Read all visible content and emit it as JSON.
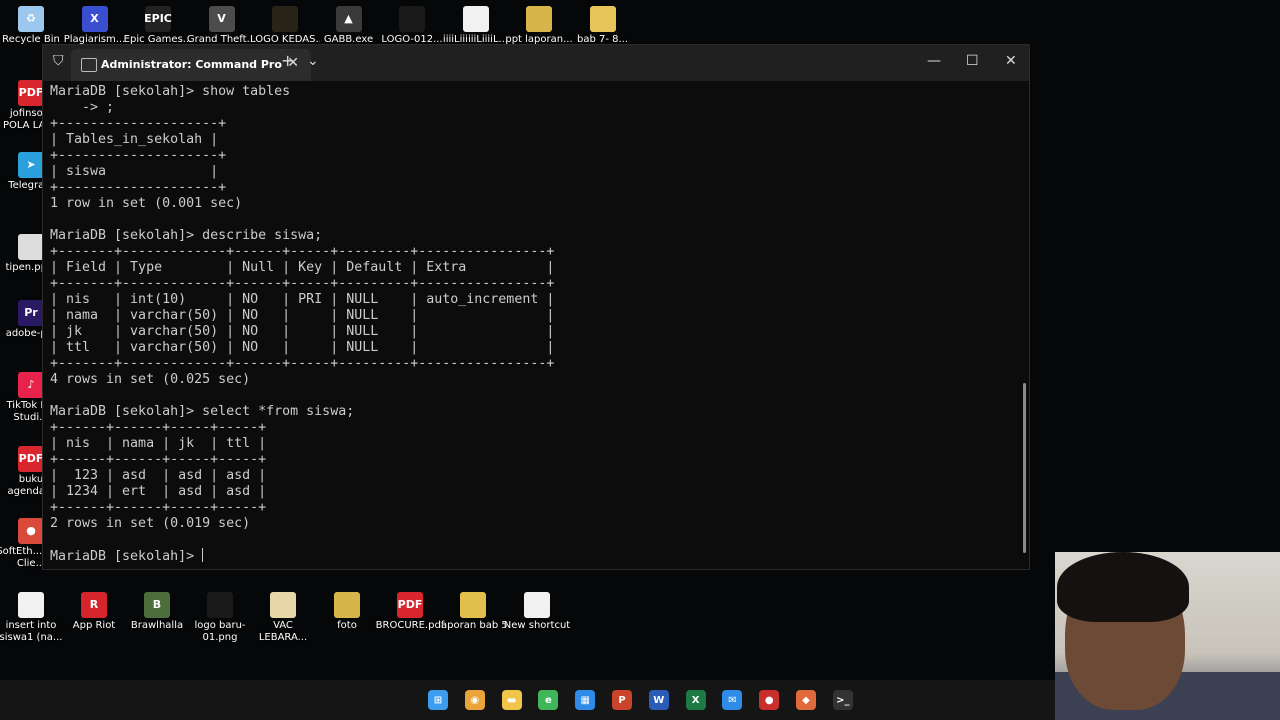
{
  "desktop": {
    "top_icons": [
      {
        "label": "Recycle Bin",
        "icon": "recycle-bin-icon",
        "color": "#9cc7ee",
        "glyph": "♻"
      },
      {
        "label": "Plagiarism...",
        "icon": "app-icon",
        "color": "#3a4fd0",
        "glyph": "X"
      },
      {
        "label": "Epic Games...",
        "icon": "epic-games-icon",
        "color": "#222222",
        "glyph": "EPIC"
      },
      {
        "label": "Grand Theft...",
        "icon": "gta-icon",
        "color": "#4c4c4c",
        "glyph": "V"
      },
      {
        "label": "LOGO KEDAS...",
        "icon": "image-icon",
        "color": "#2a2418",
        "glyph": ""
      },
      {
        "label": "GABB.exe",
        "icon": "exe-icon",
        "color": "#3a3a3a",
        "glyph": "▲"
      },
      {
        "label": "LOGO-012...",
        "icon": "image-icon",
        "color": "#1a1a1a",
        "glyph": ""
      },
      {
        "label": "iiiiLiiiiiiLiiiiL...",
        "icon": "document-icon",
        "color": "#f1f1f1",
        "glyph": ""
      },
      {
        "label": "ppt laporan...",
        "icon": "folder-icon",
        "color": "#d9b44a",
        "glyph": ""
      },
      {
        "label": "bab 7- 8...",
        "icon": "folder-icon",
        "color": "#e8c45a",
        "glyph": ""
      }
    ],
    "left_icons": [
      {
        "label": "jofinso... POLA LAT...",
        "icon": "pdf-icon",
        "color": "#d9262e",
        "glyph": "PDF"
      },
      {
        "label": "Telegra...",
        "icon": "telegram-icon",
        "color": "#2aa1da",
        "glyph": "➤"
      },
      {
        "label": "tipen.pp...",
        "icon": "image-icon",
        "color": "#dddddd",
        "glyph": ""
      },
      {
        "label": "adobe-p...",
        "icon": "premiere-icon",
        "color": "#2a1a66",
        "glyph": "Pr"
      },
      {
        "label": "TikTok L... Studi...",
        "icon": "tiktok-icon",
        "color": "#e8224a",
        "glyph": "♪"
      },
      {
        "label": "buku agenda...",
        "icon": "pdf-icon",
        "color": "#d9262e",
        "glyph": "PDF"
      },
      {
        "label": "SoftEth... VPN Clie...",
        "icon": "vpn-icon",
        "color": "#d94a3a",
        "glyph": "●"
      }
    ],
    "bottom_icons": [
      {
        "label": "insert into siswa1 (na...",
        "icon": "document-icon",
        "color": "#f1f1f1",
        "glyph": ""
      },
      {
        "label": "App Riot",
        "icon": "riot-icon",
        "color": "#d5242c",
        "glyph": "R"
      },
      {
        "label": "Brawlhalla",
        "icon": "brawlhalla-icon",
        "color": "#4d6d3a",
        "glyph": "B"
      },
      {
        "label": "logo baru-01.png",
        "icon": "image-icon",
        "color": "#1a1a1a",
        "glyph": ""
      },
      {
        "label": "VAC LEBARA...",
        "icon": "image-icon",
        "color": "#e8d7a6",
        "glyph": ""
      },
      {
        "label": "foto",
        "icon": "folder-icon",
        "color": "#d6b54a",
        "glyph": ""
      },
      {
        "label": "BROCURE.pdf",
        "icon": "pdf-icon",
        "color": "#d9262e",
        "glyph": "PDF"
      },
      {
        "label": "laporan bab 5",
        "icon": "folder-icon",
        "color": "#e2bf4c",
        "glyph": ""
      },
      {
        "label": "New shortcut",
        "icon": "shortcut-icon",
        "color": "#f1f1f1",
        "glyph": ""
      }
    ]
  },
  "window": {
    "tab_title": "Administrator: Command Pro",
    "new_tab": "+",
    "dropdown": "⌄",
    "minimize": "—",
    "maximize": "☐",
    "close": "✕",
    "tab_close": "✕"
  },
  "terminal": {
    "lines": [
      "MariaDB [sekolah]> show tables",
      "    -> ;",
      "+--------------------+",
      "| Tables_in_sekolah |",
      "+--------------------+",
      "| siswa             |",
      "+--------------------+",
      "1 row in set (0.001 sec)",
      "",
      "MariaDB [sekolah]> describe siswa;",
      "+-------+-------------+------+-----+---------+----------------+",
      "| Field | Type        | Null | Key | Default | Extra          |",
      "+-------+-------------+------+-----+---------+----------------+",
      "| nis   | int(10)     | NO   | PRI | NULL    | auto_increment |",
      "| nama  | varchar(50) | NO   |     | NULL    |                |",
      "| jk    | varchar(50) | NO   |     | NULL    |                |",
      "| ttl   | varchar(50) | NO   |     | NULL    |                |",
      "+-------+-------------+------+-----+---------+----------------+",
      "4 rows in set (0.025 sec)",
      "",
      "MariaDB [sekolah]> select *from siswa;",
      "+------+------+-----+-----+",
      "| nis  | nama | jk  | ttl |",
      "+------+------+-----+-----+",
      "|  123 | asd  | asd | asd |",
      "| 1234 | ert  | asd | asd |",
      "+------+------+-----+-----+",
      "2 rows in set (0.019 sec)",
      ""
    ],
    "prompt": "MariaDB [sekolah]> "
  },
  "taskbar": [
    {
      "name": "start-icon",
      "color": "#3b9cf0",
      "glyph": "⊞"
    },
    {
      "name": "chrome-icon",
      "color": "#e9a53a",
      "glyph": "◉"
    },
    {
      "name": "file-explorer-icon",
      "color": "#f0c54a",
      "glyph": "▬"
    },
    {
      "name": "edge-icon",
      "color": "#3fb65a",
      "glyph": "e"
    },
    {
      "name": "store-icon",
      "color": "#2f8be8",
      "glyph": "▦"
    },
    {
      "name": "powerpoint-icon",
      "color": "#c9442a",
      "glyph": "P"
    },
    {
      "name": "word-icon",
      "color": "#2b5cb5",
      "glyph": "W"
    },
    {
      "name": "excel-icon",
      "color": "#1e7a45",
      "glyph": "X"
    },
    {
      "name": "mail-icon",
      "color": "#2f8be8",
      "glyph": "✉"
    },
    {
      "name": "vpn-taskbar-icon",
      "color": "#c9302c",
      "glyph": "●"
    },
    {
      "name": "app-taskbar-icon",
      "color": "#e06a3a",
      "glyph": "◆"
    },
    {
      "name": "terminal-taskbar-icon",
      "color": "#333333",
      "glyph": ">_"
    }
  ]
}
